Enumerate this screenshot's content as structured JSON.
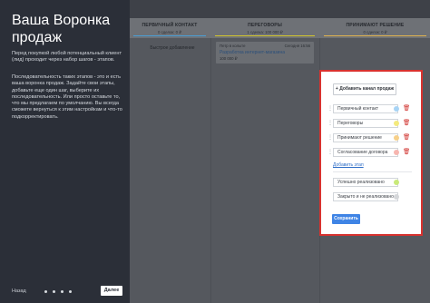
{
  "sidebar": {
    "title": "Ваша Воронка продаж",
    "paragraph1": "Перед покупкой любой потенциальный клиент (лид) проходит через набор шагов - этапов.",
    "paragraph2": "Последовательность таких этапов - это и есть ваша воронка продаж. Задайте свои этапы, добавьте еще один шаг, выберите их последовательность. Или просто оставьте то, что мы предлагаем по умолчанию. Вы всегда сможете вернуться к этим настройкам и что-то подкорректировать.",
    "back_label": "Назад",
    "next_label": "Далее",
    "step_dots": 4
  },
  "board": {
    "columns": [
      {
        "title": "ПЕРВИЧНЫЙ КОНТАКТ",
        "sub": "0 сделок: 0 ₽",
        "color": "#4a9fd6"
      },
      {
        "title": "ПЕРЕГОВОРЫ",
        "sub": "1 сделка: 100 000 ₽",
        "color": "#d4c72b"
      },
      {
        "title": "ПРИНИМАЮТ РЕШЕНИЕ",
        "sub": "0 сделок: 0 ₽",
        "color": "#e1b34f"
      }
    ],
    "quick_add": "Быстрое добавление",
    "deal": {
      "meta": "Петр в колыте",
      "right": "Сегодня 16:56",
      "name": "Разработка интернет-магазина",
      "note": "100 000 ₽"
    }
  },
  "modal": {
    "add_pipeline": "Добавить канал продаж",
    "stages": [
      {
        "label": "Первичный контакт",
        "color": "#a8d4f5"
      },
      {
        "label": "Переговоры",
        "color": "#f4ea7d"
      },
      {
        "label": "Принимают решение",
        "color": "#f7d08a"
      },
      {
        "label": "Согласование договора",
        "color": "#f7b6b0"
      }
    ],
    "add_stage": "Добавить этап",
    "final_stages": [
      {
        "label": "Успешно реализовано",
        "color": "#c9ea7a"
      },
      {
        "label": "Закрыто и не реализовано",
        "color": "#d5d7da"
      }
    ],
    "save_label": "Сохранить"
  }
}
